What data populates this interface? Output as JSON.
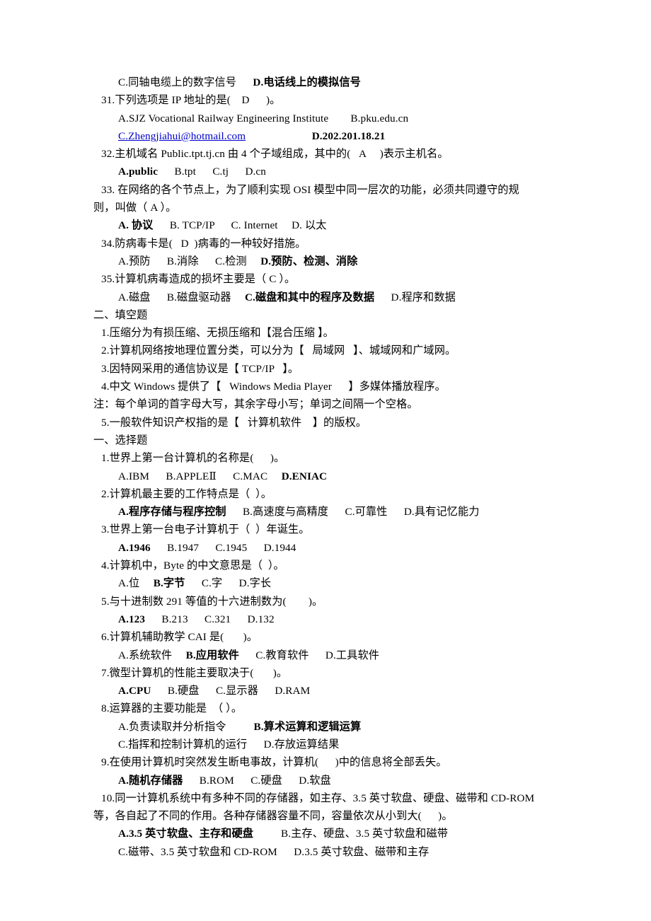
{
  "document": {
    "language": "zh-CN",
    "link_color": "#0000cc",
    "text_color": "#000000",
    "background_color": "#ffffff"
  },
  "lines": [
    {
      "id": "l01",
      "name": "question-30-options-cd",
      "indent": "opt",
      "runs": [
        {
          "text": "C.同轴电缆上的数字信号",
          "bold": false
        },
        {
          "text": "      ",
          "bold": false
        },
        {
          "text": "D.电话线上的模拟信号",
          "bold": true
        }
      ]
    },
    {
      "id": "l02",
      "name": "question-31-stem",
      "indent": "q",
      "runs": [
        {
          "text": "31.下列选项是 IP 地址的是(    D      )。",
          "bold": false
        }
      ]
    },
    {
      "id": "l03",
      "name": "question-31-options-ab",
      "indent": "opt",
      "runs": [
        {
          "text": "A.SJZ Vocational Railway Engineering Institute",
          "bold": false
        },
        {
          "text": "        ",
          "bold": false
        },
        {
          "text": "B.pku.edu.cn",
          "bold": false
        }
      ]
    },
    {
      "id": "l04",
      "name": "question-31-options-cd",
      "indent": "opt",
      "runs": [
        {
          "text": "C.Zhengjiahui@hotmail.com",
          "bold": false,
          "link": true
        },
        {
          "text": "                        ",
          "bold": false
        },
        {
          "text": "D.202.201.18.21",
          "bold": true
        }
      ]
    },
    {
      "id": "l05",
      "name": "question-32-stem",
      "indent": "q",
      "runs": [
        {
          "text": "32.主机域名 Public.tpt.tj.cn 由 4 个子域组成，其中的(   A     )表示主机名。",
          "bold": false
        }
      ]
    },
    {
      "id": "l06",
      "name": "question-32-options",
      "indent": "opt",
      "runs": [
        {
          "text": "A.public",
          "bold": true
        },
        {
          "text": "      B.tpt      C.tj      D.cn",
          "bold": false
        }
      ]
    },
    {
      "id": "l07",
      "name": "question-33-stem-line1",
      "indent": "q",
      "runs": [
        {
          "text": "33. 在网络的各个节点上，为了顺利实现 OSI 模型中同一层次的功能，必须共同遵守的规",
          "bold": false
        }
      ]
    },
    {
      "id": "l08",
      "name": "question-33-stem-line2",
      "indent": "0",
      "runs": [
        {
          "text": "则，叫做（ A ）。",
          "bold": false
        }
      ]
    },
    {
      "id": "l09",
      "name": "question-33-options",
      "indent": "opt",
      "runs": [
        {
          "text": "A. 协议",
          "bold": true
        },
        {
          "text": "      B. TCP/IP      C. Internet     D. 以太",
          "bold": false
        }
      ]
    },
    {
      "id": "l10",
      "name": "question-34-stem",
      "indent": "q",
      "runs": [
        {
          "text": "34.防病毒卡是(   D  )病毒的一种较好措施。",
          "bold": false
        }
      ]
    },
    {
      "id": "l11",
      "name": "question-34-options",
      "indent": "opt",
      "runs": [
        {
          "text": "A.预防      B.消除      C.检测     ",
          "bold": false
        },
        {
          "text": "D.预防、检测、消除",
          "bold": true
        }
      ]
    },
    {
      "id": "l12",
      "name": "question-35-stem",
      "indent": "q",
      "runs": [
        {
          "text": "35.计算机病毒造成的损坏主要是（ C ）。",
          "bold": false
        }
      ]
    },
    {
      "id": "l13",
      "name": "question-35-options",
      "indent": "opt",
      "runs": [
        {
          "text": "A.磁盘      B.磁盘驱动器     ",
          "bold": false
        },
        {
          "text": "C.磁盘和其中的程序及数据",
          "bold": true
        },
        {
          "text": "      D.程序和数据",
          "bold": false
        }
      ]
    },
    {
      "id": "l14",
      "name": "section-heading-fill-in-blank",
      "indent": "sec",
      "runs": [
        {
          "text": "二、填空题",
          "bold": false
        }
      ]
    },
    {
      "id": "l15",
      "name": "blank-1",
      "indent": "q",
      "runs": [
        {
          "text": "1.压缩分为有损压缩、无损压缩和【混合压缩 】。",
          "bold": false
        }
      ]
    },
    {
      "id": "l16",
      "name": "blank-2",
      "indent": "q",
      "runs": [
        {
          "text": "2.计算机网络按地理位置分类，可以分为【   局域网   】、城域网和广域网。",
          "bold": false
        }
      ]
    },
    {
      "id": "l17",
      "name": "blank-3",
      "indent": "q",
      "runs": [
        {
          "text": "3.因特网采用的通信协议是【 TCP/IP   】。",
          "bold": false
        }
      ]
    },
    {
      "id": "l18",
      "name": "blank-4",
      "indent": "q",
      "runs": [
        {
          "text": "4.中文 Windows 提供了【   Windows Media Player      】多媒体播放程序。",
          "bold": false
        }
      ]
    },
    {
      "id": "l19",
      "name": "blank-note",
      "indent": "0",
      "runs": [
        {
          "text": "注：每个单词的首字母大写，其余字母小写；单词之间隔一个空格。",
          "bold": false
        }
      ]
    },
    {
      "id": "l20",
      "name": "blank-5",
      "indent": "q",
      "runs": [
        {
          "text": "5.一般软件知识产权指的是【   计算机软件    】的版权。",
          "bold": false
        }
      ]
    },
    {
      "id": "l21",
      "name": "section-heading-multiple-choice",
      "indent": "sec",
      "runs": [
        {
          "text": "一、选择题",
          "bold": false
        }
      ]
    },
    {
      "id": "l22",
      "name": "question-1-stem",
      "indent": "q",
      "runs": [
        {
          "text": "1.世界上第一台计算机的名称是(      )。",
          "bold": false
        }
      ]
    },
    {
      "id": "l23",
      "name": "question-1-options",
      "indent": "opt",
      "runs": [
        {
          "text": "A.IBM      B.APPLEⅡ      C.MAC     ",
          "bold": false
        },
        {
          "text": "D.ENIAC",
          "bold": true
        }
      ]
    },
    {
      "id": "l24",
      "name": "question-2-stem",
      "indent": "q",
      "runs": [
        {
          "text": "2.计算机最主要的工作特点是（  ）。",
          "bold": false
        }
      ]
    },
    {
      "id": "l25",
      "name": "question-2-options",
      "indent": "opt",
      "runs": [
        {
          "text": "A.程序存储与程序控制",
          "bold": true
        },
        {
          "text": "      B.高速度与高精度      C.可靠性      D.具有记忆能力",
          "bold": false
        }
      ]
    },
    {
      "id": "l26",
      "name": "question-3-stem",
      "indent": "q",
      "runs": [
        {
          "text": "3.世界上第一台电子计算机于（  ）年诞生。",
          "bold": false
        }
      ]
    },
    {
      "id": "l27",
      "name": "question-3-options",
      "indent": "opt",
      "runs": [
        {
          "text": "A.1946",
          "bold": true
        },
        {
          "text": "      B.1947      C.1945      D.1944",
          "bold": false
        }
      ]
    },
    {
      "id": "l28",
      "name": "question-4-stem",
      "indent": "q",
      "runs": [
        {
          "text": "4.计算机中，Byte 的中文意思是（  ）。",
          "bold": false
        }
      ]
    },
    {
      "id": "l29",
      "name": "question-4-options",
      "indent": "opt",
      "runs": [
        {
          "text": "A.位     ",
          "bold": false
        },
        {
          "text": "B.字节",
          "bold": true
        },
        {
          "text": "      C.字      D.字长",
          "bold": false
        }
      ]
    },
    {
      "id": "l30",
      "name": "question-5-stem",
      "indent": "q",
      "runs": [
        {
          "text": "5.与十进制数 291 等值的十六进制数为(        )。",
          "bold": false
        }
      ]
    },
    {
      "id": "l31",
      "name": "question-5-options",
      "indent": "opt",
      "runs": [
        {
          "text": "A.123",
          "bold": true
        },
        {
          "text": "      B.213      C.321      D.132",
          "bold": false
        }
      ]
    },
    {
      "id": "l32",
      "name": "question-6-stem",
      "indent": "q",
      "runs": [
        {
          "text": "6.计算机辅助教学 CAI 是(       )。",
          "bold": false
        }
      ]
    },
    {
      "id": "l33",
      "name": "question-6-options",
      "indent": "opt",
      "runs": [
        {
          "text": "A.系统软件     ",
          "bold": false
        },
        {
          "text": "B.应用软件",
          "bold": true
        },
        {
          "text": "      C.教育软件      D.工具软件",
          "bold": false
        }
      ]
    },
    {
      "id": "l34",
      "name": "question-7-stem",
      "indent": "q",
      "runs": [
        {
          "text": "7.微型计算机的性能主要取决于(       )。",
          "bold": false
        }
      ]
    },
    {
      "id": "l35",
      "name": "question-7-options",
      "indent": "opt",
      "runs": [
        {
          "text": "A.CPU",
          "bold": true
        },
        {
          "text": "      B.硬盘      C.显示器      D.RAM",
          "bold": false
        }
      ]
    },
    {
      "id": "l36",
      "name": "question-8-stem",
      "indent": "q",
      "runs": [
        {
          "text": "8.运算器的主要功能是  （ ）。",
          "bold": false
        }
      ]
    },
    {
      "id": "l37",
      "name": "question-8-options-ab",
      "indent": "opt",
      "runs": [
        {
          "text": "A.负责读取并分析指令          ",
          "bold": false
        },
        {
          "text": "B.算术运算和逻辑运算",
          "bold": true
        }
      ]
    },
    {
      "id": "l38",
      "name": "question-8-options-cd",
      "indent": "opt",
      "runs": [
        {
          "text": "C.指挥和控制计算机的运行      D.存放运算结果",
          "bold": false
        }
      ]
    },
    {
      "id": "l39",
      "name": "question-9-stem",
      "indent": "q",
      "runs": [
        {
          "text": "9.在使用计算机时突然发生断电事故，计算机(      )中的信息将全部丢失。",
          "bold": false
        }
      ]
    },
    {
      "id": "l40",
      "name": "question-9-options",
      "indent": "opt",
      "runs": [
        {
          "text": "A.随机存储器",
          "bold": true
        },
        {
          "text": "      B.ROM      C.硬盘      D.软盘",
          "bold": false
        }
      ]
    },
    {
      "id": "l41",
      "name": "question-10-stem-line1",
      "indent": "q",
      "runs": [
        {
          "text": "10.同一计算机系统中有多种不同的存储器，如主存、3.5 英寸软盘、硬盘、磁带和 CD-ROM",
          "bold": false
        }
      ]
    },
    {
      "id": "l42",
      "name": "question-10-stem-line2",
      "indent": "0",
      "runs": [
        {
          "text": "等，各自起了不同的作用。各种存储器容量不同，容量依次从小到大(      )。",
          "bold": false
        }
      ]
    },
    {
      "id": "l43",
      "name": "question-10-options-ab",
      "indent": "opt",
      "runs": [
        {
          "text": "A.3.5 英寸软盘、主存和硬盘",
          "bold": true
        },
        {
          "text": "          B.主存、硬盘、3.5 英寸软盘和磁带",
          "bold": false
        }
      ]
    },
    {
      "id": "l44",
      "name": "question-10-options-cd",
      "indent": "opt",
      "runs": [
        {
          "text": "C.磁带、3.5 英寸软盘和 CD-ROM      D.3.5 英寸软盘、磁带和主存",
          "bold": false
        }
      ]
    }
  ]
}
